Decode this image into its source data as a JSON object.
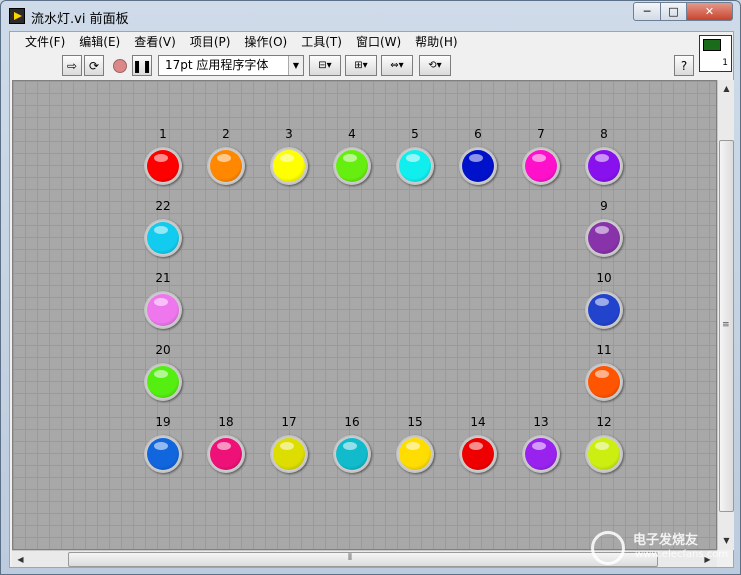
{
  "window": {
    "title": "流水灯.vi 前面板",
    "min_label": "─",
    "max_label": "□",
    "close_label": "✕"
  },
  "menu": [
    "文件(F)",
    "编辑(E)",
    "查看(V)",
    "项目(P)",
    "操作(O)",
    "工具(T)",
    "窗口(W)",
    "帮助(H)"
  ],
  "toolbar": {
    "font_select": "17pt 应用程序字体",
    "help_label": "?",
    "vi_icon_number": "1"
  },
  "leds": [
    {
      "label": "1",
      "color": "#ff0000"
    },
    {
      "label": "2",
      "color": "#ff8800"
    },
    {
      "label": "3",
      "color": "#ffff00"
    },
    {
      "label": "4",
      "color": "#66ee11"
    },
    {
      "label": "5",
      "color": "#11eeee"
    },
    {
      "label": "6",
      "color": "#0011cc"
    },
    {
      "label": "7",
      "color": "#ff11cc"
    },
    {
      "label": "8",
      "color": "#8811ee"
    },
    {
      "label": "9",
      "color": "#8833aa"
    },
    {
      "label": "10",
      "color": "#2244cc"
    },
    {
      "label": "11",
      "color": "#ff5500"
    },
    {
      "label": "12",
      "color": "#ccee11"
    },
    {
      "label": "13",
      "color": "#9922ee"
    },
    {
      "label": "14",
      "color": "#ee0000"
    },
    {
      "label": "15",
      "color": "#ffdd00"
    },
    {
      "label": "16",
      "color": "#11bbcc"
    },
    {
      "label": "17",
      "color": "#dddd00"
    },
    {
      "label": "18",
      "color": "#ee1177"
    },
    {
      "label": "19",
      "color": "#1166dd"
    },
    {
      "label": "20",
      "color": "#55ee11"
    },
    {
      "label": "21",
      "color": "#ee77ee"
    },
    {
      "label": "22",
      "color": "#11ccee"
    }
  ],
  "watermark": {
    "text": "电子发烧友",
    "site": "www.elecfans.com"
  }
}
